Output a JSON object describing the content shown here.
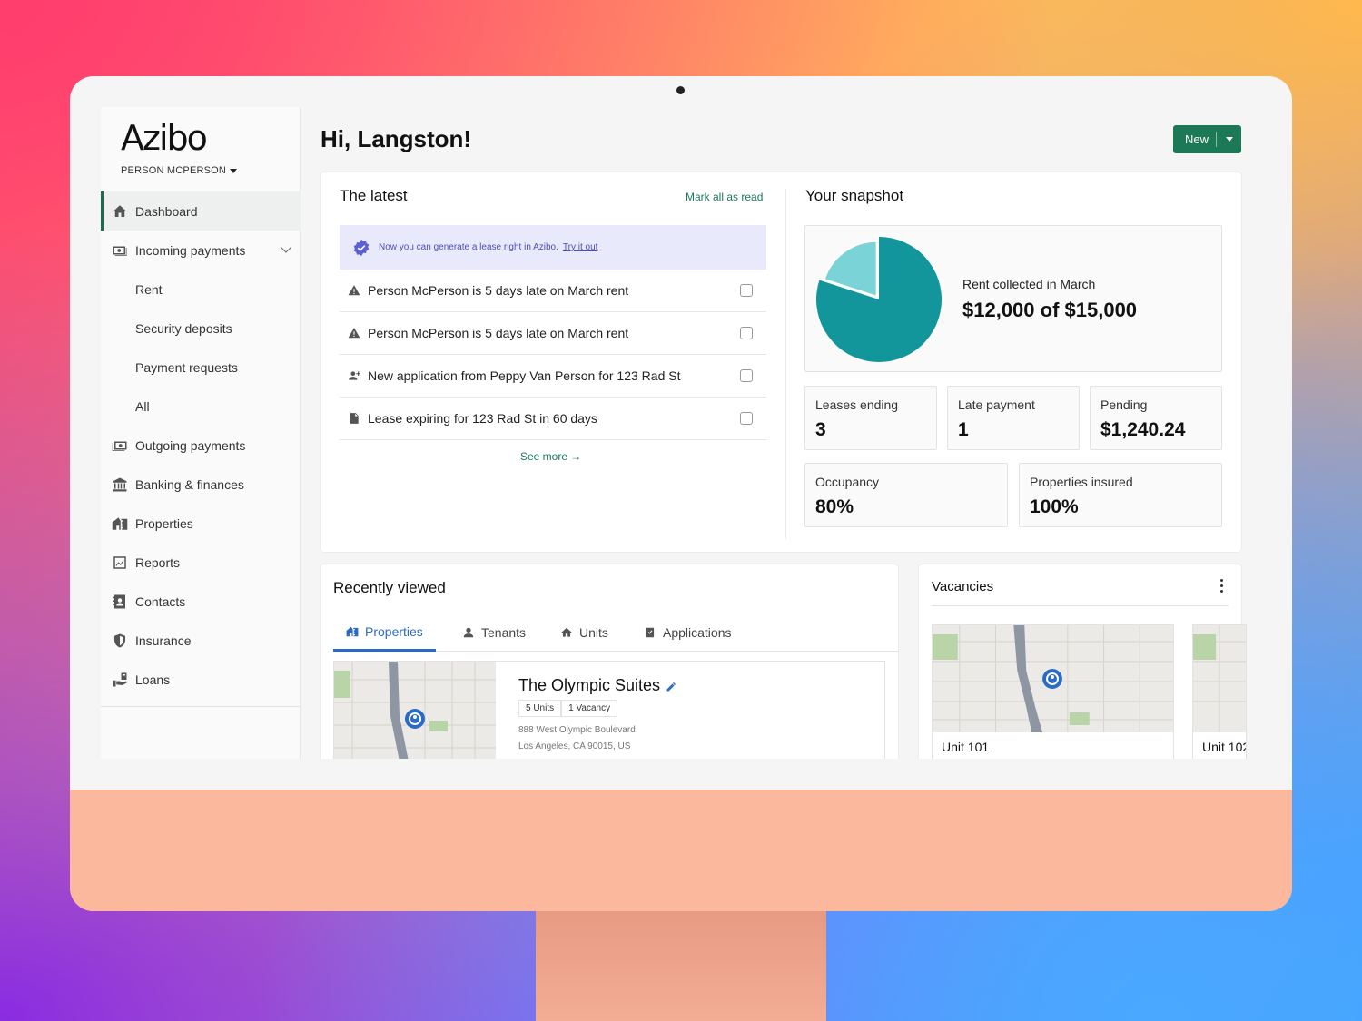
{
  "app": {
    "logo": "Azibo",
    "user": "PERSON MCPERSON"
  },
  "sidebar": {
    "items": [
      {
        "label": "Dashboard",
        "icon": "home-icon"
      },
      {
        "label": "Incoming payments",
        "icon": "cash-icon"
      },
      {
        "label": "Rent"
      },
      {
        "label": "Security deposits"
      },
      {
        "label": "Payment requests"
      },
      {
        "label": "All"
      },
      {
        "label": "Outgoing payments",
        "icon": "cash-out-icon"
      },
      {
        "label": "Banking & finances",
        "icon": "bank-icon"
      },
      {
        "label": "Properties",
        "icon": "building-icon"
      },
      {
        "label": "Reports",
        "icon": "chart-icon"
      },
      {
        "label": "Contacts",
        "icon": "contacts-icon"
      },
      {
        "label": "Insurance",
        "icon": "shield-icon"
      },
      {
        "label": "Loans",
        "icon": "loan-icon"
      }
    ]
  },
  "header": {
    "greeting": "Hi, Langston!",
    "new_label": "New"
  },
  "latest": {
    "title": "The latest",
    "mark_all": "Mark all as read",
    "banner_text": "Now you can generate a lease right in Azibo.",
    "banner_link": "Try it out",
    "items": [
      {
        "text": "Person McPerson is 5 days late on March rent",
        "icon": "warning-icon"
      },
      {
        "text": "Person McPerson is 5 days late on March rent",
        "icon": "warning-icon"
      },
      {
        "text": "New application from Peppy Van Person for 123 Rad St",
        "icon": "user-add-icon"
      },
      {
        "text": "Lease expiring for 123 Rad St in 60 days",
        "icon": "document-icon"
      }
    ],
    "see_more": "See more"
  },
  "snapshot": {
    "title": "Your snapshot",
    "rent_label": "Rent collected in March",
    "rent_value": "$12,000 of $15,000",
    "rent_collected": 12000,
    "rent_total": 15000,
    "colors": {
      "collected": "#12969b",
      "remaining": "#7ad3d6"
    },
    "stats": [
      {
        "label": "Leases ending",
        "value": "3"
      },
      {
        "label": "Late payment",
        "value": "1"
      },
      {
        "label": "Pending",
        "value": "$1,240.24"
      },
      {
        "label": "Occupancy",
        "value": "80%"
      },
      {
        "label": "Properties insured",
        "value": "100%"
      }
    ]
  },
  "recent": {
    "title": "Recently viewed",
    "tabs": [
      "Properties",
      "Tenants",
      "Units",
      "Applications"
    ],
    "property": {
      "name": "The Olympic Suites",
      "units": "5 Units",
      "vacancy": "1 Vacancy",
      "address1": "888 West Olympic Boulevard",
      "address2": "Los Angeles, CA 90015, US"
    }
  },
  "vacancies": {
    "title": "Vacancies",
    "units": [
      "Unit 101",
      "Unit 102"
    ]
  }
}
